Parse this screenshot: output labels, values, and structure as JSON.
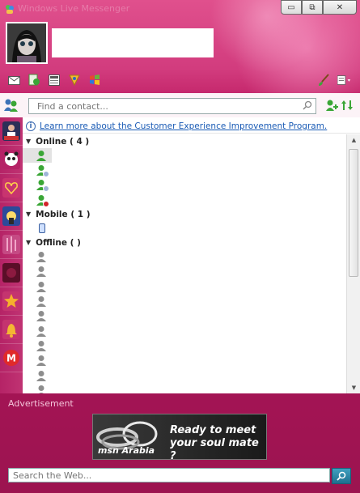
{
  "window": {
    "title": "Windows Live Messenger",
    "minimize_glyph": "▭",
    "restore_glyph": "⧉",
    "close_glyph": "✕"
  },
  "search": {
    "placeholder": "Find a contact..."
  },
  "info_bar": {
    "link_text": "Learn more about the Customer Experience Improvement Program."
  },
  "groups": [
    {
      "name": "Online",
      "count_text": "( 4 )"
    },
    {
      "name": "Mobile",
      "count_text": "( 1 )"
    },
    {
      "name": "Offline",
      "count_text": "(        )"
    }
  ],
  "online_contacts": [
    {
      "status": "online",
      "selected": true
    },
    {
      "status": "away"
    },
    {
      "status": "away"
    },
    {
      "status": "busy"
    }
  ],
  "offline_contacts_count": 10,
  "footer": {
    "ad_label": "Advertisement",
    "ad_line1": "Ready to meet",
    "ad_line2": "your soul mate ?",
    "ad_brand": "msn Arabia",
    "web_search_placeholder": "Search the Web..."
  },
  "colors": {
    "theme": "#c82c70",
    "link": "#1a5bb5",
    "online": "#3aa636",
    "away": "#3d73b8",
    "busy": "#d2232a",
    "offline": "#8d8d8d"
  }
}
